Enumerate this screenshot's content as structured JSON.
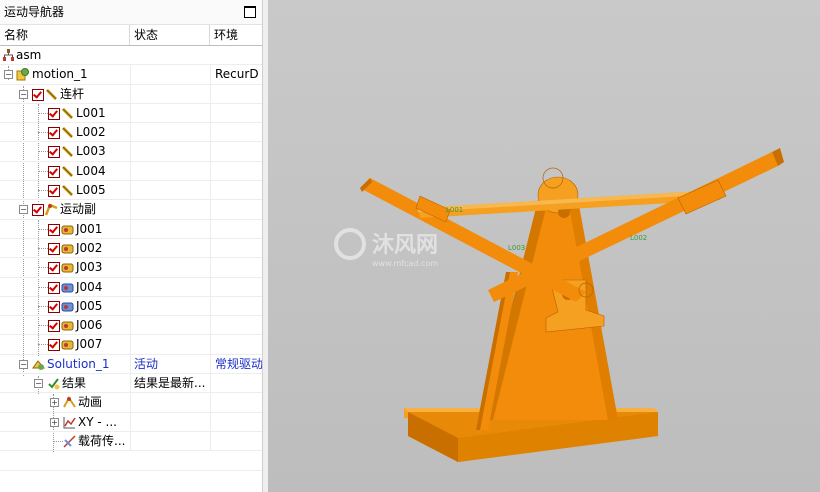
{
  "navigator": {
    "title": "运动导航器",
    "columns": {
      "name": "名称",
      "status": "状态",
      "env": "环境"
    },
    "rows": {
      "asm": "asm",
      "motion": {
        "label": "motion_1",
        "env": "RecurD"
      },
      "links": "连杆",
      "l001": "L001",
      "l002": "L002",
      "l003": "L003",
      "l004": "L004",
      "l005": "L005",
      "joints": "运动副",
      "j001": "J001",
      "j002": "J002",
      "j003": "J003",
      "j004": "J004",
      "j005": "J005",
      "j006": "J006",
      "j007": "J007",
      "solution": {
        "label": "Solution_1",
        "status": "活动",
        "env": "常规驱动"
      },
      "results": {
        "label": "结果",
        "status": "结果是最新..."
      },
      "animation": "动画",
      "xy": "XY - ...",
      "load": "载荷传..."
    }
  },
  "viewport": {
    "watermark_text": "沐风网",
    "watermark_url": "www.mfcad.com",
    "labels": {
      "l001": "L001",
      "l002": "L002",
      "l003": "L003"
    },
    "colors": {
      "model": "#f28c0a",
      "model_dark": "#c86f00",
      "background": "#c4c4c4",
      "accent_red": "#d40000"
    }
  }
}
